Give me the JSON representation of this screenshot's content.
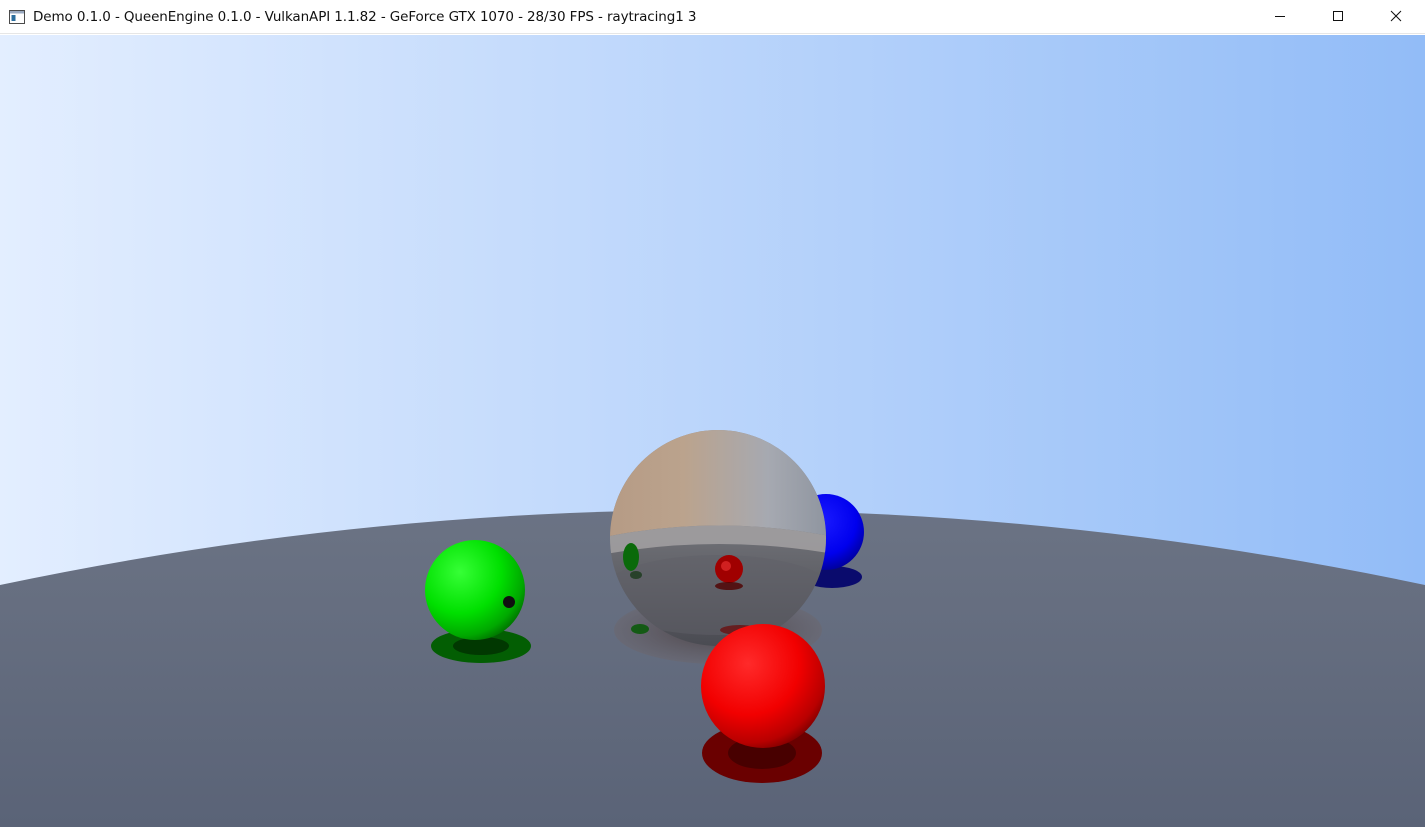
{
  "window": {
    "title": "Demo 0.1.0 - QueenEngine 0.1.0 - VulkanAPI 1.1.82 - GeForce GTX 1070 - 28/30 FPS - raytracing1 3",
    "app_icon": "window-app-icon",
    "controls": [
      {
        "name": "minimize",
        "icon": "minimize-icon"
      },
      {
        "name": "maximize",
        "icon": "maximize-icon"
      },
      {
        "name": "close",
        "icon": "close-icon"
      }
    ]
  },
  "scene": {
    "description_colors": {
      "sky_left": "#e3eeff",
      "sky_right": "#92bcf7",
      "floor": "#5d6679",
      "green_sphere": "#00d800",
      "red_sphere": "#ee0000",
      "blue_sphere": "#0000ee",
      "metal_sphere": "#9a9591"
    }
  }
}
